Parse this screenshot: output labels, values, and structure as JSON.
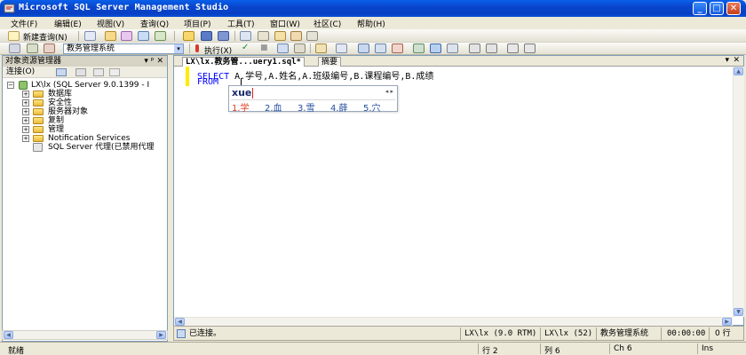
{
  "window": {
    "title": "Microsoft SQL Server Management Studio",
    "minimize_glyph": "_",
    "maximize_glyph": "□",
    "close_glyph": "✕"
  },
  "menu": {
    "items": [
      "文件(F)",
      "编辑(E)",
      "视图(V)",
      "查询(Q)",
      "项目(P)",
      "工具(T)",
      "窗口(W)",
      "社区(C)",
      "帮助(H)"
    ]
  },
  "toolbar1": {
    "new_query_label": "新建查询(N)"
  },
  "toolbar2": {
    "database_selected": "教务管理系统",
    "dropdown_glyph": "▾",
    "execute_label": "执行(X)",
    "check_glyph": "✓",
    "stop_glyph": "■"
  },
  "object_explorer": {
    "title": "对象资源管理器",
    "pin_glyph": "▾ ᵖ ✕",
    "connect_label": "连接(O)",
    "root": "LX\\lx (SQL Server 9.0.1399 - I",
    "nodes": [
      "数据库",
      "安全性",
      "服务器对象",
      "复制",
      "管理",
      "Notification Services"
    ],
    "agent_node": "SQL Server 代理(已禁用代理",
    "expand_glyph": "+",
    "collapse_glyph": "−"
  },
  "editor": {
    "tab_label": "LX\\lx.教务管...uery1.sql*",
    "summary_tab": "摘要",
    "close_glyph": "✕",
    "dropdown_glyph": "▾",
    "code_line1_kw": "SELECT",
    "code_line1_rest": " A.学号,A.姓名,A.班级编号,B.课程编号,B.成绩",
    "code_line2_kw": "FROM"
  },
  "ime": {
    "input": "xue",
    "nav": "◂ ▸",
    "candidates": [
      "1.学",
      "2.血",
      "3.雪",
      "4.薛",
      "5.穴"
    ]
  },
  "editor_status": {
    "connection": "已连接。",
    "server": "LX\\lx (9.0 RTM)",
    "user": "LX\\lx (52)",
    "database": "教务管理系统",
    "time": "00:00:00",
    "rows": "0 行"
  },
  "statusbar": {
    "ready": "就绪",
    "line": "行 2",
    "column": "列 6",
    "char": "Ch 6",
    "mode": "Ins"
  }
}
